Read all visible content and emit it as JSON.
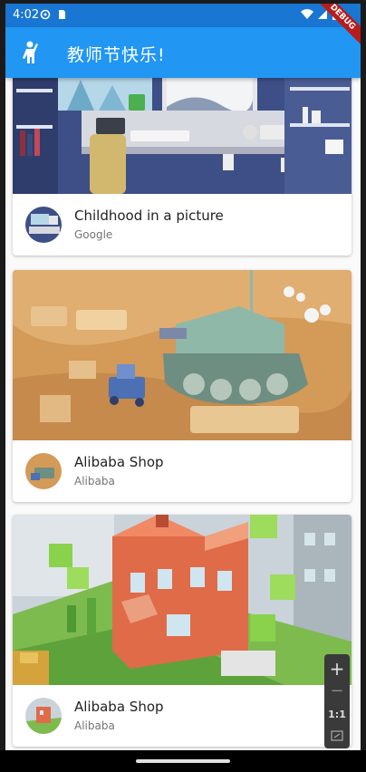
{
  "status_bar": {
    "time": "4:02"
  },
  "app_bar": {
    "title": "教师节快乐!",
    "debug_label": "DEBUG"
  },
  "cards": [
    {
      "title": "Childhood in a picture",
      "subtitle": "Google"
    },
    {
      "title": "Alibaba Shop",
      "subtitle": "Alibaba"
    },
    {
      "title": "Alibaba Shop",
      "subtitle": "Alibaba"
    }
  ],
  "zoom_controls": {
    "zoom_in": "+",
    "zoom_out": "−",
    "one_to_one": "1:1"
  },
  "colors": {
    "status_bar": "#1976d2",
    "app_bar": "#2196f3",
    "debug": "#b71c1c"
  }
}
